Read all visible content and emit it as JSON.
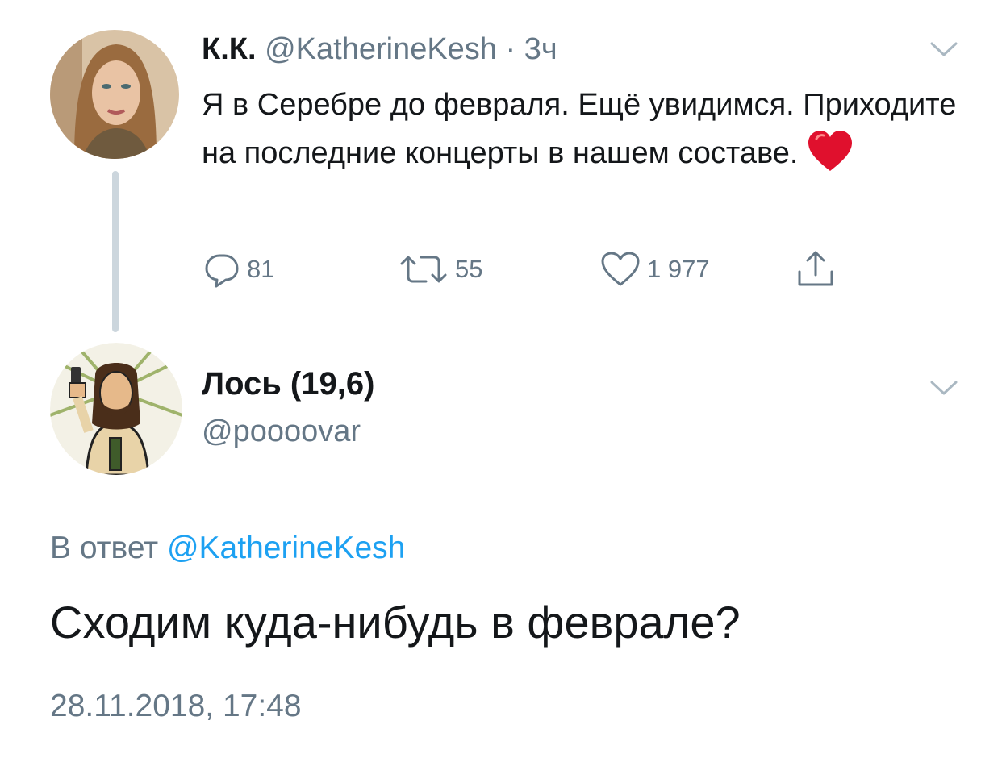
{
  "tweet1": {
    "name": "К.К.",
    "handle": "@KatherineKesh",
    "separator": "·",
    "time": "3ч",
    "text": "Я в Серебре до февраля. Ещё увидимся. Приходите на последние концерты в нашем составе.",
    "emoji": "heart-emoji",
    "actions": {
      "reply_count": "81",
      "retweet_count": "55",
      "like_count": "1 977"
    }
  },
  "tweet2": {
    "name": "Лось (19,6)",
    "handle": "@poooovar",
    "reply_to_prefix": "В ответ",
    "reply_to_mention": "@KatherineKesh",
    "text": "Сходим куда-нибудь в феврале?",
    "date": "28.11.2018, 17:48"
  },
  "colors": {
    "text": "#14171a",
    "secondary": "#657786",
    "link": "#1da1f2",
    "thread_line": "#ccd6dd",
    "heart": "#e0102d"
  },
  "icons": [
    "chevron-down-icon",
    "reply-icon",
    "retweet-icon",
    "like-icon",
    "share-icon"
  ]
}
